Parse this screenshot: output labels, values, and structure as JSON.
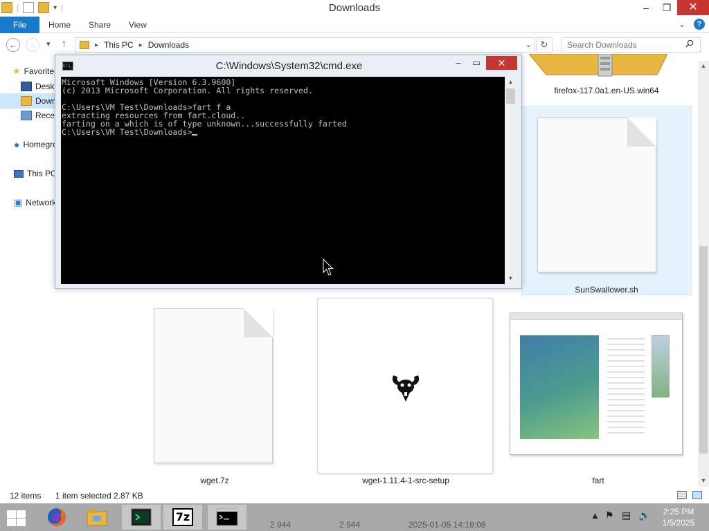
{
  "explorer": {
    "title": "Downloads",
    "ribbon": {
      "tabs": [
        "File",
        "Home",
        "Share",
        "View"
      ]
    },
    "address": {
      "crumbs": [
        "This PC",
        "Downloads"
      ]
    },
    "search": {
      "placeholder": "Search Downloads"
    },
    "sidebar": {
      "items": [
        {
          "label": "Favorites",
          "icon": "star-icon"
        },
        {
          "label": "Desktop",
          "icon": "desktop-icon"
        },
        {
          "label": "Downloads",
          "icon": "downloads-folder-icon",
          "selected": true
        },
        {
          "label": "Recent places",
          "icon": "recent-icon"
        },
        {
          "label": "Homegroup",
          "icon": "homegroup-icon"
        },
        {
          "label": "This PC",
          "icon": "computer-icon"
        },
        {
          "label": "Network",
          "icon": "network-icon"
        }
      ]
    },
    "files": {
      "firefox": "firefox-117.0a1.en-US.win64",
      "sunswallower": "SunSwallower.sh",
      "wget7z": "wget.7z",
      "wgetsetup": "wget-1.11.4-1-src-setup",
      "fart": "fart"
    },
    "status": {
      "items": "12 items",
      "selected": "1 item selected",
      "size": "2.87 KB"
    }
  },
  "cmd": {
    "title": "C:\\Windows\\System32\\cmd.exe",
    "icon_label": "C:\\_",
    "lines": [
      "Microsoft Windows [Version 6.3.9600]",
      "(c) 2013 Microsoft Corporation. All rights reserved.",
      "",
      "C:\\Users\\VM Test\\Downloads>fart f a",
      "extracting resources from fart.cloud..",
      "farting on a which is of type unknown...successfully farted",
      "C:\\Users\\VM Test\\Downloads>"
    ]
  },
  "taskbar": {
    "apps": [
      "Firefox",
      "File Explorer",
      "Terminal",
      "7z",
      "Command Prompt"
    ],
    "sevenzip_label": "7z",
    "ghost": {
      "a": "2 944",
      "b": "2 944",
      "c": "2025-01-05 14:19:08"
    },
    "clock": {
      "time": "2:25 PM",
      "date": "1/5/2025"
    }
  },
  "colors": {
    "accent": "#1979ca",
    "close": "#c7372f",
    "selection": "#cce8ff",
    "taskbar": "#a9a9a9"
  }
}
